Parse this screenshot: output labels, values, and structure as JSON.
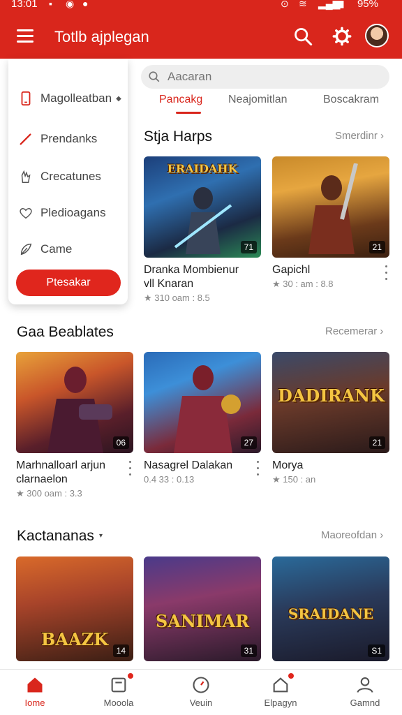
{
  "status": {
    "time": "13:01",
    "battery": "95%"
  },
  "appbar": {
    "title": "Totlb ajplegan"
  },
  "drawer": {
    "items": [
      {
        "label": "Magolleatban",
        "icon": "phone-icon"
      },
      {
        "label": "Prendanks",
        "icon": "pencil-icon"
      },
      {
        "label": "Crecatunes",
        "icon": "hand-icon"
      },
      {
        "label": "Pledioagans",
        "icon": "heart-icon"
      },
      {
        "label": "Came",
        "icon": "leaf-icon"
      }
    ],
    "cta": "Ptesakar"
  },
  "search": {
    "placeholder": "Aacaran"
  },
  "tabs": [
    {
      "label": "Pancakg",
      "active": true
    },
    {
      "label": "Neajomitlan",
      "active": false
    },
    {
      "label": "Boscakram",
      "active": false
    }
  ],
  "sections": [
    {
      "title": "Stja Harps",
      "more": "Smerdinr",
      "cards": [
        {
          "name": "Dranka Mombienur vll Knaran",
          "meta": "★ 310 oam : 8.5",
          "badge": "71",
          "logo": "ERAIDAHK"
        },
        {
          "name": "Gapichl",
          "meta": "★ 30 : am : 8.8",
          "badge": "21",
          "logo": ""
        }
      ]
    },
    {
      "title": "Gaa Beablates",
      "more": "Recemerar",
      "cards": [
        {
          "name": "Marhnalloarl arjun clarnaelon",
          "meta": "★ 300 oam : 3.3",
          "badge": "06",
          "logo": ""
        },
        {
          "name": "Nasagrel Dalakan",
          "meta": "0.4 33 : 0.13",
          "badge": "27",
          "logo": ""
        },
        {
          "name": "Morya",
          "meta": "★ 150 : an",
          "badge": "21",
          "logo": "DADIRANK"
        }
      ]
    },
    {
      "title": "Kactananas",
      "more": "Maoreofdan",
      "cards": [
        {
          "name": "",
          "meta": "",
          "badge": "14",
          "logo": "BAAZK"
        },
        {
          "name": "",
          "meta": "",
          "badge": "31",
          "logo": "SANIMAR"
        },
        {
          "name": "",
          "meta": "",
          "badge": "S1",
          "logo": "SRAIDANE"
        }
      ]
    }
  ],
  "nav": [
    {
      "label": "Iome",
      "icon": "home-icon",
      "active": true
    },
    {
      "label": "Mooola",
      "icon": "inbox-icon",
      "active": false
    },
    {
      "label": "Veuin",
      "icon": "compass-icon",
      "active": false
    },
    {
      "label": "Elpagyn",
      "icon": "house-icon",
      "active": false
    },
    {
      "label": "Gamnd",
      "icon": "person-icon",
      "active": false
    }
  ],
  "colors": {
    "accent": "#d9261c"
  }
}
